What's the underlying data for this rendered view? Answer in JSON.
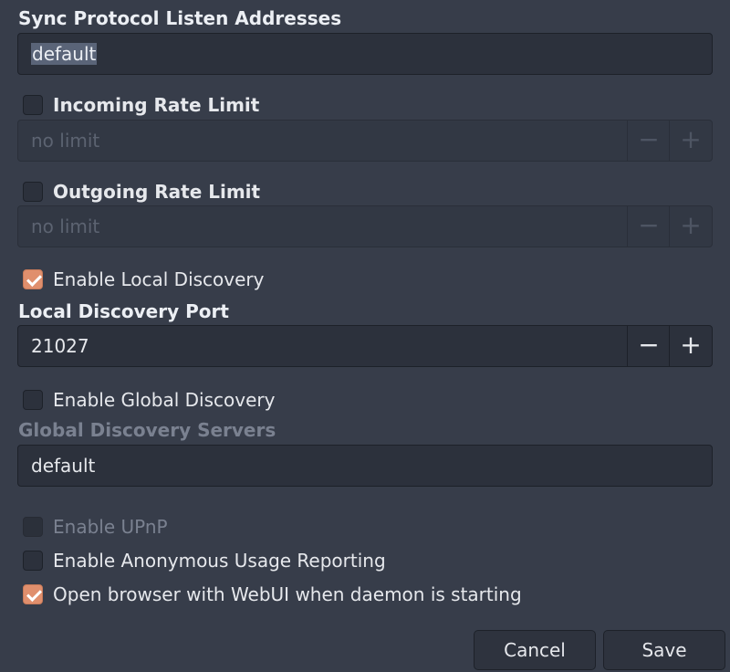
{
  "sync_listen": {
    "label": "Sync Protocol Listen Addresses",
    "value": "default"
  },
  "incoming": {
    "label": "Incoming Rate Limit",
    "checked": false,
    "value": "no limit",
    "minus": "−",
    "plus": "+"
  },
  "outgoing": {
    "label": "Outgoing Rate Limit",
    "checked": false,
    "value": "no limit",
    "minus": "−",
    "plus": "+"
  },
  "local_discovery": {
    "label": "Enable Local Discovery",
    "checked": true
  },
  "local_port": {
    "label": "Local Discovery Port",
    "value": "21027",
    "minus": "−",
    "plus": "+"
  },
  "global_discovery": {
    "label": "Enable Global Discovery",
    "checked": false
  },
  "global_servers": {
    "label": "Global Discovery Servers",
    "value": "default"
  },
  "upnp": {
    "label": "Enable UPnP",
    "checked": false,
    "disabled": true
  },
  "usage_reporting": {
    "label": "Enable Anonymous Usage Reporting",
    "checked": false
  },
  "open_browser": {
    "label": "Open browser with WebUI when daemon is starting",
    "checked": true
  },
  "buttons": {
    "cancel": "Cancel",
    "save": "Save"
  },
  "colors": {
    "background": "#373d4a",
    "accent": "#e08f6d",
    "entry": "#2c313c"
  }
}
